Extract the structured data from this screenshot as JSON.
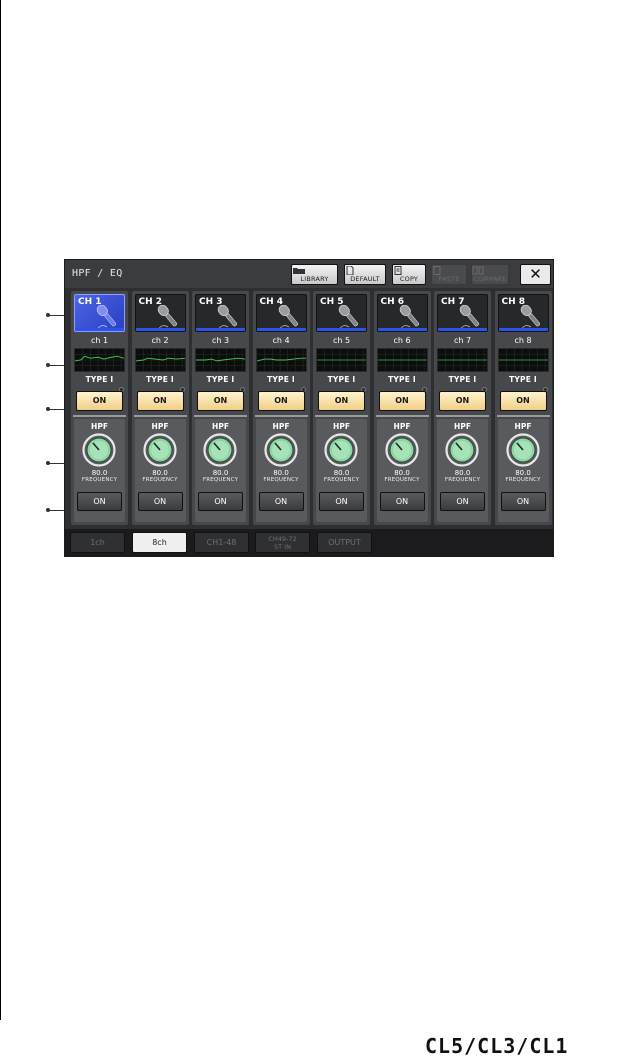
{
  "window": {
    "title": "HPF / EQ",
    "toolbar": {
      "library": "LIBRARY",
      "default": "DEFAULT",
      "copy": "COPY",
      "paste": "PASTE",
      "compare": "COMPARE",
      "close_icon": "close-icon"
    }
  },
  "channels": [
    {
      "num": "CH 1",
      "name": "ch 1",
      "type": "TYPE I",
      "eq_on": "ON",
      "hpf_label": "HPF",
      "freq_value": "80.0",
      "freq_label": "FREQUENCY",
      "hpf_on": "ON"
    },
    {
      "num": "CH 2",
      "name": "ch 2",
      "type": "TYPE I",
      "eq_on": "ON",
      "hpf_label": "HPF",
      "freq_value": "80.0",
      "freq_label": "FREQUENCY",
      "hpf_on": "ON"
    },
    {
      "num": "CH 3",
      "name": "ch 3",
      "type": "TYPE I",
      "eq_on": "ON",
      "hpf_label": "HPF",
      "freq_value": "80.0",
      "freq_label": "FREQUENCY",
      "hpf_on": "ON"
    },
    {
      "num": "CH 4",
      "name": "ch 4",
      "type": "TYPE I",
      "eq_on": "ON",
      "hpf_label": "HPF",
      "freq_value": "80.0",
      "freq_label": "FREQUENCY",
      "hpf_on": "ON"
    },
    {
      "num": "CH 5",
      "name": "ch 5",
      "type": "TYPE I",
      "eq_on": "ON",
      "hpf_label": "HPF",
      "freq_value": "80.0",
      "freq_label": "FREQUENCY",
      "hpf_on": "ON"
    },
    {
      "num": "CH 6",
      "name": "ch 6",
      "type": "TYPE I",
      "eq_on": "ON",
      "hpf_label": "HPF",
      "freq_value": "80.0",
      "freq_label": "FREQUENCY",
      "hpf_on": "ON"
    },
    {
      "num": "CH 7",
      "name": "ch 7",
      "type": "TYPE I",
      "eq_on": "ON",
      "hpf_label": "HPF",
      "freq_value": "80.0",
      "freq_label": "FREQUENCY",
      "hpf_on": "ON"
    },
    {
      "num": "CH 8",
      "name": "ch 8",
      "type": "TYPE I",
      "eq_on": "ON",
      "hpf_label": "HPF",
      "freq_value": "80.0",
      "freq_label": "FREQUENCY",
      "hpf_on": "ON"
    }
  ],
  "tabs": {
    "t1": "1ch",
    "t2": "8ch",
    "t3": "CH1-48",
    "t4a": "CH49-72",
    "t4b": "ST IN",
    "t5": "OUTPUT",
    "active": "8ch"
  },
  "brand": "CL5/CL3/CL1",
  "colors": {
    "selected_channel": "#3f57de",
    "eq_on": "#f5dca0",
    "knob": "#8fd6a5",
    "channel_bar": "#2b55e8"
  }
}
